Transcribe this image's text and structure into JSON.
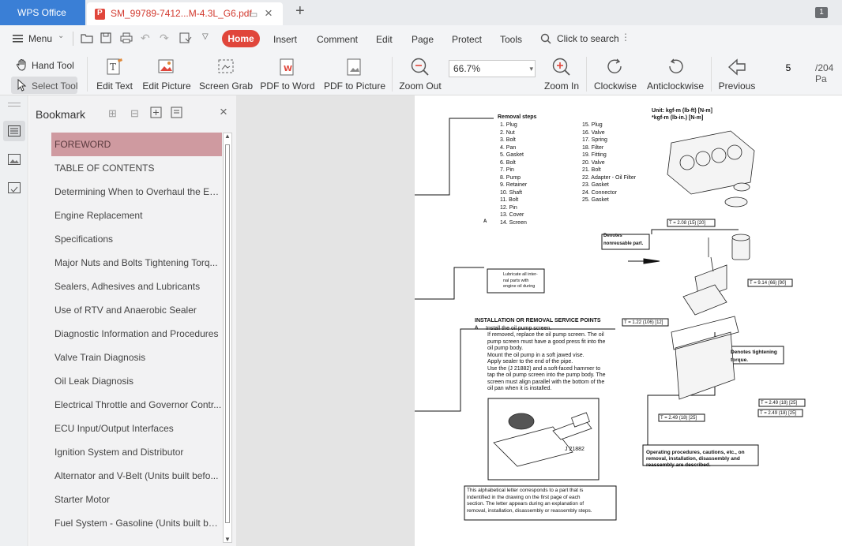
{
  "app": {
    "name": "WPS Office",
    "tab_title": "SM_99789-7412...M-4.3L_G6.pdf",
    "window_badge": "1"
  },
  "menu": {
    "menu_label": "Menu",
    "items": [
      "Home",
      "Insert",
      "Comment",
      "Edit",
      "Page",
      "Protect",
      "Tools"
    ],
    "search": "Click to search"
  },
  "toolbar": {
    "hand_tool": "Hand Tool",
    "select_tool": "Select Tool",
    "edit_text": "Edit Text",
    "edit_picture": "Edit Picture",
    "screen_grab": "Screen Grab",
    "pdf_to_word": "PDF to Word",
    "pdf_to_picture": "PDF to Picture",
    "zoom_out": "Zoom Out",
    "zoom_value": "66.7%",
    "zoom_in": "Zoom In",
    "clockwise": "Clockwise",
    "anticlockwise": "Anticlockwise",
    "previous": "Previous",
    "page_value": "5",
    "page_total": "/204 Pa"
  },
  "bookmark": {
    "title": "Bookmark",
    "items": [
      "FOREWORD",
      "TABLE OF CONTENTS",
      "Determining When to Overhaul the En...",
      "Engine Replacement",
      "Specifications",
      "Major Nuts and Bolts Tightening Torq...",
      "Sealers, Adhesives and Lubricants",
      "Use of RTV and Anaerobic Sealer",
      "Diagnostic Information and Procedures",
      "Valve Train Diagnosis",
      "Oil Leak Diagnosis",
      "Electrical Throttle and Governor Contr...",
      "ECU Input/Output Interfaces",
      "Ignition System and Distributor",
      "Alternator and V-Belt (Units built befo...",
      "Starter Motor",
      "Fuel System - Gasoline (Units built bef..."
    ],
    "selected_index": 0
  },
  "page": {
    "removal_title": "Removal steps",
    "steps_left": [
      "1. Plug",
      "2. Nut",
      "3. Bolt",
      "4. Pan",
      "5. Gasket",
      "6. Bolt",
      "7. Pin",
      "8. Pump",
      "9. Retainer",
      "10. Shaft",
      "11. Bolt",
      "12. Pin",
      "13. Cover",
      "14. Screen"
    ],
    "steps_right": [
      "15. Plug",
      "16. Valve",
      "17. Spring",
      "18. Filter",
      "19. Fitting",
      "20. Valve",
      "21. Bolt",
      "22. Adapter - Oil Filter",
      "23. Gasket",
      "24. Connector",
      "25. Gasket"
    ],
    "unit_line1": "Unit: kgf-m (lb-ft) [N-m]",
    "unit_line2": "*kgf-m (lb-in.) [N-m]",
    "service_title": "INSTALLATION OR REMOVAL SERVICE POINTS",
    "service_head": "Install the oil pump screen.",
    "service_lines": [
      "If removed, replace the oil pump screen. The oil",
      "pump screen must have a good press fit into the",
      "oil pump body.",
      "Mount the oil pump in a soft jawed vise.",
      "Apply sealer to the end of the pipe.",
      "Use the (J 21882) and a soft-faced hammer to",
      "tap the oil pump screen into the pump body. The",
      "screen must align parallel with the bottom of the",
      "oil pan when it is installed."
    ],
    "tool_label": "J 21882",
    "nonreusable": "Denotes\nnonreusable part.",
    "lubricate": "Lubricate all inter-\nnal parts with\nengine oil during",
    "tightening": "Denotes tightening\ntorque.",
    "operating": "Operating procedures, cautions, etc., on\nremoval, installation, disassembly and\nreassembly are described.",
    "letter_note": "This alphabetical letter corresponds to a part that is\nindentified in the drawing on the first page of each\nsection. The letter appears during an explanation of\nremoval, installation, disassembly or reassembly steps.",
    "torques": [
      "T = 2.08  (15) [20]",
      "T = 9.14  (66) [90]",
      "T = 1.22  (106) [12]",
      "T = 2.49  (18) [25]",
      "T = 2.49 (18) [25]",
      "T = 2.49 (18) [25]"
    ],
    "part_letter": "A"
  }
}
